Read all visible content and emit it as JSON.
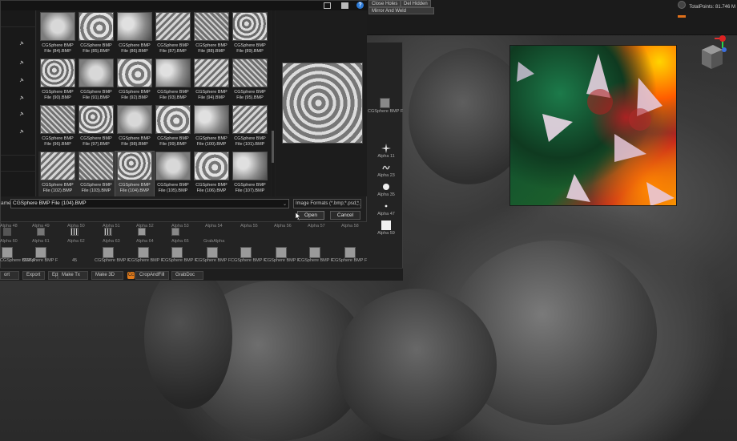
{
  "top_bar": {
    "buttons": [
      "Close Holes",
      "Del Hidden",
      "Mirror And Weld"
    ],
    "total_points": "TotalPoints: 81.746 M"
  },
  "dialog": {
    "files": [
      {
        "name": "CGSphere BMP File (84).BMP"
      },
      {
        "name": "CGSphere BMP File (85).BMP"
      },
      {
        "name": "CGSphere BMP File (86).BMP"
      },
      {
        "name": "CGSphere BMP File (87).BMP"
      },
      {
        "name": "CGSphere BMP File (88).BMP"
      },
      {
        "name": "CGSphere BMP File (89).BMP"
      },
      {
        "name": "CGSphere BMP File (90).BMP"
      },
      {
        "name": "CGSphere BMP File (91).BMP"
      },
      {
        "name": "CGSphere BMP File (92).BMP"
      },
      {
        "name": "CGSphere BMP File (93).BMP"
      },
      {
        "name": "CGSphere BMP File (94).BMP"
      },
      {
        "name": "CGSphere BMP File (95).BMP"
      },
      {
        "name": "CGSphere BMP File (96).BMP"
      },
      {
        "name": "CGSphere BMP File (97).BMP"
      },
      {
        "name": "CGSphere BMP File (98).BMP"
      },
      {
        "name": "CGSphere BMP File (99).BMP"
      },
      {
        "name": "CGSphere BMP File (100).BMP"
      },
      {
        "name": "CGSphere BMP File (101).BMP"
      },
      {
        "name": "CGSphere BMP File (102).BMP"
      },
      {
        "name": "CGSphere BMP File (103).BMP"
      },
      {
        "name": "CGSphere BMP File (104).BMP"
      },
      {
        "name": "CGSphere BMP File (105).BMP"
      },
      {
        "name": "CGSphere BMP File (106).BMP"
      },
      {
        "name": "CGSphere BMP File (107).BMP"
      }
    ],
    "filename_label": "ame:",
    "filename_value": "CGSphere BMP File (104).BMP",
    "filetype_value": "Image Formats (*.bmp;*.psd;*.j",
    "open_label": "Open",
    "cancel_label": "Cancel"
  },
  "alpha_palette": {
    "side_items": [
      "Alpha 11",
      "Alpha 23",
      "Alpha 35",
      "Alpha 47",
      "Alpha 59"
    ],
    "side_thumb_label": "CGSphere BMP F",
    "row_labels": [
      "Alpha 48",
      "Alpha 49",
      "Alpha 50",
      "Alpha 51",
      "Alpha 52",
      "Alpha 53",
      "Alpha 54",
      "Alpha 55",
      "Alpha 56",
      "Alpha 57",
      "Alpha 58"
    ],
    "row2_labels": [
      "Alpha 60",
      "Alpha 61",
      "Alpha 62",
      "Alpha 63",
      "Alpha 64",
      "Alpha 65",
      "GrabAlpha"
    ],
    "thumb_labels": [
      "CGSphere BMP F",
      "CGSphere BMP F",
      "45",
      "CGSphere BMP F",
      "CGSphere BMP F",
      "CGSphere BMP F",
      "CGSphere BMP F",
      "CGSphere BMP F",
      "CGSphere BMP F",
      "CGSphere BMP F",
      "CGSphere BMP F"
    ]
  },
  "bottom_bar": {
    "buttons": [
      "ort",
      "Export",
      "Ep",
      "Make Tx",
      "Make 3D",
      "CropAndFill",
      "GrabDoc"
    ],
    "cropfill_badge": "Cc"
  }
}
